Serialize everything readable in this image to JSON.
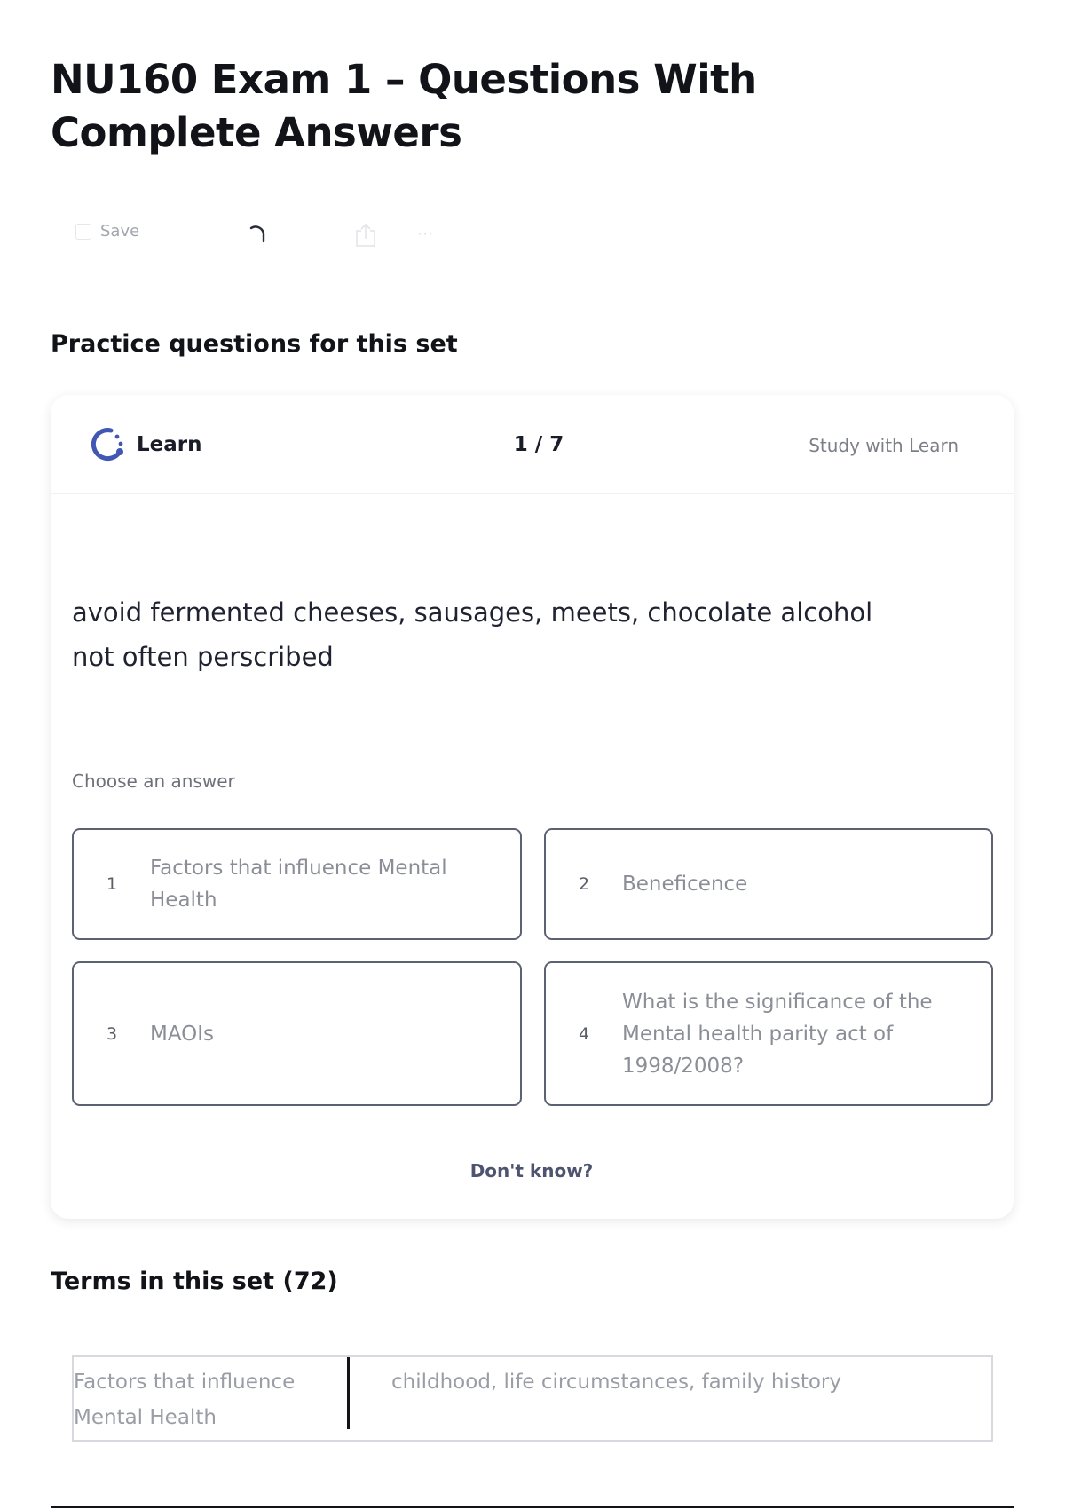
{
  "page": {
    "title": "NU160 Exam 1 – Questions With Complete Answers"
  },
  "toolbar": {
    "save_label": "Save",
    "icons": [
      "checkbox-icon",
      "loading-spinner-icon",
      "share-icon",
      "more-icon"
    ]
  },
  "practice": {
    "heading": "Practice questions for this set",
    "card": {
      "mode_label": "Learn",
      "progress": "1 / 7",
      "study_link": "Study with Learn",
      "prompt_lines": [
        "avoid fermented cheeses, sausages, meets, chocolate alcohol",
        "not often perscribed"
      ],
      "choose_label": "Choose an answer",
      "answers": [
        {
          "number": "1",
          "text": "Factors that influence Mental Health"
        },
        {
          "number": "2",
          "text": "Beneficence"
        },
        {
          "number": "3",
          "text": "MAOIs"
        },
        {
          "number": "4",
          "text": "What is the significance of the Mental health parity act of 1998/2008?"
        }
      ],
      "dont_know": "Don't know?"
    }
  },
  "terms": {
    "heading": "Terms in this set (72)",
    "rows": [
      {
        "term": "Factors that influence Mental Health",
        "definition": "childhood, life circumstances, family history"
      }
    ]
  },
  "colors": {
    "brand_learn": "#4257b2",
    "text_primary": "#1a1d28",
    "text_muted": "#8b8e96",
    "answer_border": "#5d6272"
  }
}
